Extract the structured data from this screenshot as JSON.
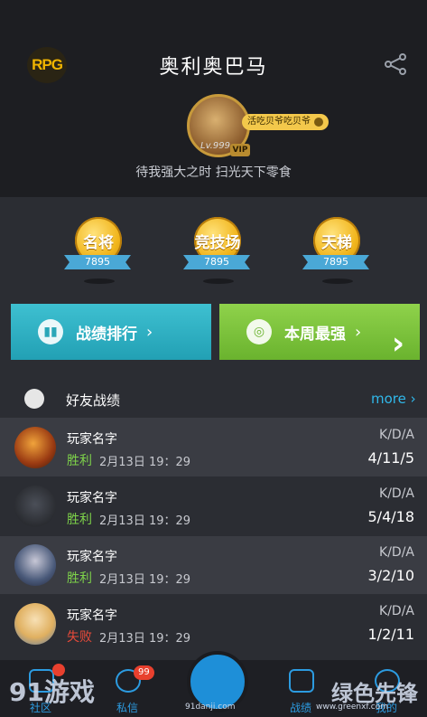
{
  "header": {
    "logo_text": "RPG",
    "title": "奥利奥巴马",
    "avatar_pill": "活吃贝爷吃贝爷",
    "level": "Lv.999",
    "vip": "VIP",
    "motto": "待我强大之时 扫光天下零食"
  },
  "badges": [
    {
      "name": "名将",
      "value": "7895"
    },
    {
      "name": "竞技场",
      "value": "7895"
    },
    {
      "name": "天梯",
      "value": "7895"
    }
  ],
  "actions": {
    "rank_label": "战绩排行",
    "week_label": "本周最强"
  },
  "friends": {
    "title": "好友战绩",
    "more": "more",
    "kda_label": "K/D/A",
    "rows": [
      {
        "name": "玩家名字",
        "result": "胜利",
        "date": "2月13日 19：29",
        "kda": "4/11/5",
        "result_color": "#7ed34a"
      },
      {
        "name": "玩家名字",
        "result": "胜利",
        "date": "2月13日 19：29",
        "kda": "5/4/18",
        "result_color": "#7ed34a"
      },
      {
        "name": "玩家名字",
        "result": "胜利",
        "date": "2月13日 19：29",
        "kda": "3/2/10",
        "result_color": "#7ed34a"
      },
      {
        "name": "玩家名字",
        "result": "失败",
        "date": "2月13日 19：29",
        "kda": "1/2/11",
        "result_color": "#e84a3a"
      }
    ]
  },
  "nav": {
    "items": [
      "社区",
      "私信",
      "战绩",
      "我的"
    ],
    "messages_badge": "99"
  },
  "watermark": {
    "left": "91游戏",
    "left_sub": "91danji.com",
    "right": "绿色先锋",
    "right_sub": "www.greenxf.com"
  },
  "colors": {
    "accent": "#30b8ea",
    "win": "#7ed34a",
    "loss": "#e84a3a"
  }
}
